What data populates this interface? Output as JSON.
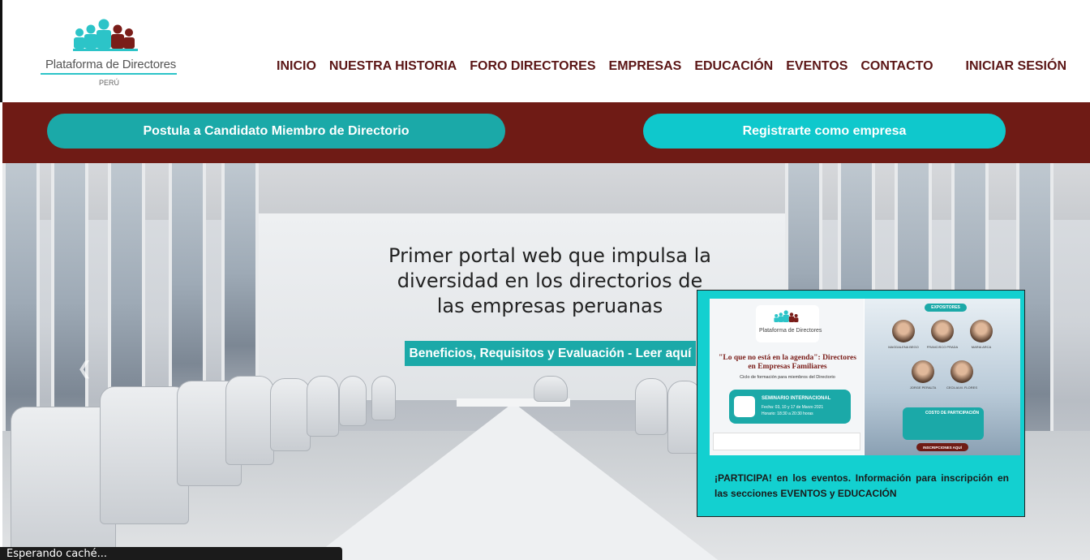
{
  "logo": {
    "brand": "Plataforma de Directores",
    "country": "PERÚ"
  },
  "nav": {
    "items": [
      "INICIO",
      "NUESTRA HISTORIA",
      "FORO DIRECTORES",
      "EMPRESAS",
      "EDUCACIÓN",
      "EVENTOS",
      "CONTACTO"
    ],
    "login": "INICIAR SESIÓN"
  },
  "band": {
    "candidate_button": "Postula a Candidato Miembro de Directorio",
    "company_button": "Registrarte como empresa"
  },
  "hero": {
    "title": "Primer portal web que impulsa la diversidad en los directorios de las empresas peruanas",
    "cta": "Beneficios, Requisitos y Evaluación - Leer aquí",
    "prev_icon": "chevron-left-icon",
    "next_icon": "chevron-right-icon"
  },
  "popup": {
    "flyer": {
      "logo_text": "Plataforma de Directores",
      "quote": "\"Lo que no está en la agenda\": Directores en Empresas Familiares",
      "cycle": "Ciclo de formación para miembros del Directorio",
      "seminar_title": "SEMINARIO INTERNACIONAL",
      "seminar_date": "Fecha: 03, 10 y 17 de Marzo 2021",
      "seminar_time": "Horario: 18:30 a 20:30 horas",
      "speakers_label": "EXPOSITORES",
      "speakers": [
        "MAGDALENA BEGO",
        "FRANCISCO PRADA",
        "MARIA ARCA",
        "JORGE PERALTA",
        "CECILIA M. FLORES"
      ],
      "cost_title": "COSTO DE PARTICIPACIÓN",
      "signup": "INSCRIPCIONES AQUÍ"
    },
    "text": "¡PARTICIPA! en los eventos. Información para inscripción en las secciones EVENTOS y EDUCACIÓN"
  },
  "status": {
    "text": "Esperando caché..."
  },
  "colors": {
    "maroon": "#6f1b15",
    "teal": "#1ba9a8",
    "cyan": "#0fc8cc",
    "nav_text": "#5b1616"
  }
}
